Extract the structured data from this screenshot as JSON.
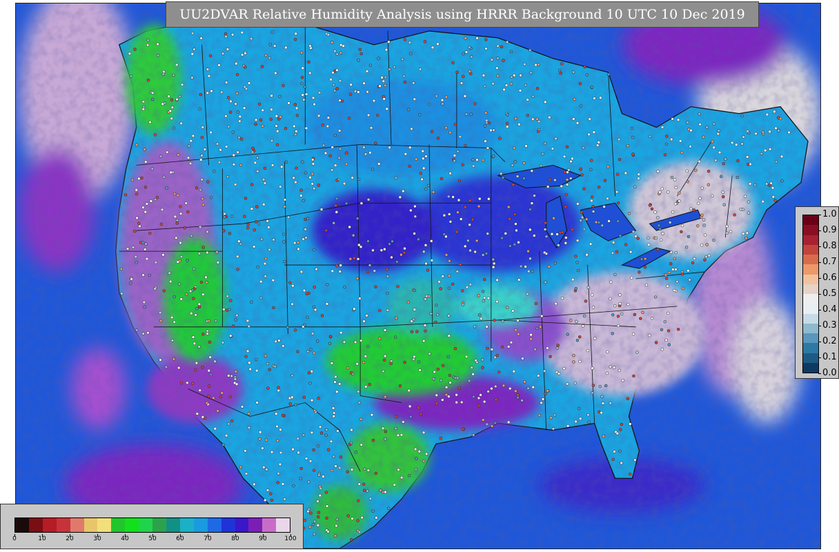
{
  "title": "UU2DVAR Relative Humidity Analysis using HRRR Background 10 UTC 10 Dec 2019",
  "rh_colorbar": {
    "ticks": [
      "0",
      "10",
      "20",
      "30",
      "40",
      "50",
      "60",
      "70",
      "80",
      "90",
      "100"
    ],
    "colors": [
      "#1a0a0a",
      "#7a0e15",
      "#b51c26",
      "#c8323a",
      "#e0796b",
      "#e9c56a",
      "#f2df7a",
      "#21c62c",
      "#12e01c",
      "#1fd44a",
      "#2ca24c",
      "#119184",
      "#1bb0c6",
      "#1a9ae0",
      "#1d6ae4",
      "#1f33d8",
      "#3a17c8",
      "#7a1eb5",
      "#c86cc7",
      "#e9d6ea"
    ]
  },
  "weight_colorbar": {
    "ticks": [
      "1.0",
      "0.9",
      "0.8",
      "0.7",
      "0.6",
      "0.5",
      "0.4",
      "0.3",
      "0.2",
      "0.1",
      "0.0"
    ],
    "colors": [
      "#0d3a63",
      "#1c5a86",
      "#2c79a4",
      "#5997bc",
      "#8fb9cf",
      "#c6dbe7",
      "#e8eef2",
      "#eeeeee",
      "#e6d2c8",
      "#f2c29d",
      "#ed9969",
      "#d96b4d",
      "#c2443b",
      "#a82130",
      "#8a0e21",
      "#6a0016"
    ]
  },
  "map_colors": {
    "ocean": "#1f57d8",
    "land_mid": "#1aa4e0",
    "very_moist": "#d4d0d6",
    "moist": "#7b26c0",
    "dry": "#23cb35",
    "boundary": "#111111"
  }
}
